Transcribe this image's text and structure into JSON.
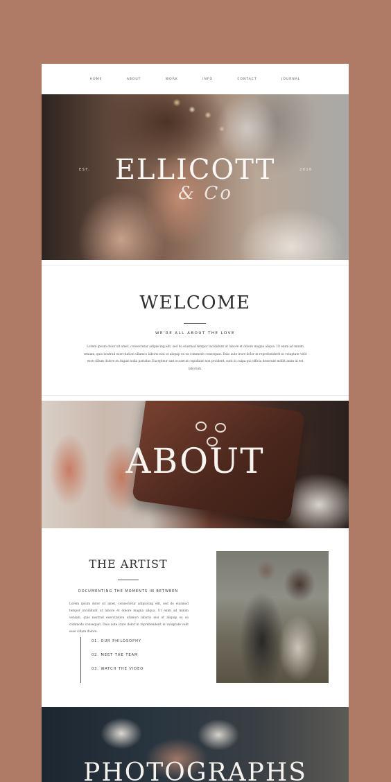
{
  "nav": {
    "items": [
      "HOME",
      "ABOUT",
      "WORK",
      "INFO",
      "CONTACT",
      "JOURNAL"
    ]
  },
  "hero": {
    "est_label": "EST.",
    "brand": "ELLICOTT",
    "brand_sub": "& Co",
    "year": "2016"
  },
  "welcome": {
    "title": "WELCOME",
    "tagline": "WE'RE ALL ABOUT THE LOVE",
    "body": "Lorem ipsum dolor sit amet, consectetur adipiscing elit, sed do eiusmod tempor incididunt ut labore et dolore magna aliqua. Ut enim ad minim veniam, quis nostrud exercitation ullamco laboris nisi ut aliquip ex ea commodo consequat. Duis aute irure dolor in reprehenderit in voluptate velit esse cillum dolore eu fugiat nulla pariatur. Excepteur sint occaecat cupidatat non proident, sunt in culpa qui officia deserunt mollit anim id est laborum."
  },
  "about": {
    "title": "ABOUT"
  },
  "artist": {
    "title": "THE ARTIST",
    "tagline": "DOCUMENTING THE MOMENTS IN BETWEEN",
    "body": "Lorem ipsum dolor sit amet, consectetur adipiscing elit, sed do eiusmod tempor incididunt ut labore et dolore magna aliqua. Ut enim ad minim veniam, quis nostrud exercitation ullamco laboris nisi ut aliquip ex ea commodo consequat. Duis aute irure dolor in reprehenderit in voluptate velit esse cillum dolore.",
    "links": [
      "01. OUR PHILOSOPHY",
      "02. MEET THE TEAM",
      "03. WATCH THE VIDEO"
    ]
  },
  "photographs": {
    "title": "PHOTOGRAPHS"
  },
  "colors": {
    "background": "#b07b66",
    "page": "#ffffff",
    "text": "#2e2e2e"
  }
}
